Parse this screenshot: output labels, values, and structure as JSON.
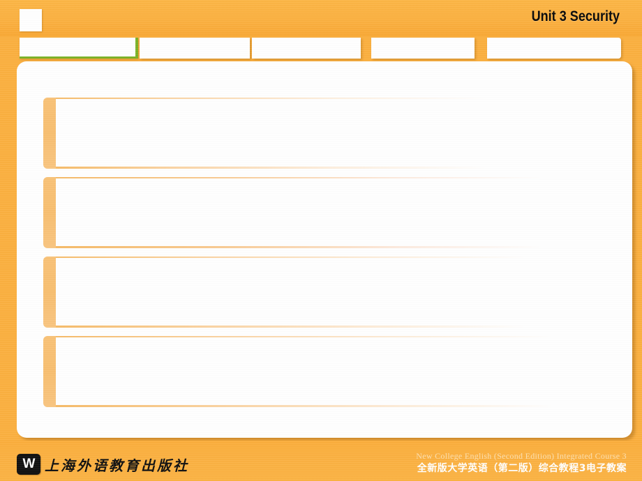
{
  "slide": {
    "background_color": "#fbb040",
    "panel_color": "#ffffff"
  },
  "header": {
    "title": "Unit 3 Security",
    "logo_placeholder_label": ""
  },
  "tabs": [
    {
      "label": "",
      "active": true,
      "accent_color": "#7cb227"
    },
    {
      "label": "",
      "active": false,
      "accent_color": ""
    },
    {
      "label": "",
      "active": false,
      "accent_color": ""
    },
    {
      "label": "",
      "active": false,
      "accent_color": ""
    },
    {
      "label": "",
      "active": false,
      "accent_color": ""
    }
  ],
  "content": {
    "rows": [
      {
        "text": ""
      },
      {
        "text": ""
      },
      {
        "text": ""
      },
      {
        "text": ""
      }
    ]
  },
  "footer": {
    "press_mark": "W",
    "press_name": "上海外语教育出版社",
    "line_en": "New College English (Second Edition) Integrated Course 3",
    "line_cn": "全新版大学英语（第二版）综合教程3电子教案"
  }
}
